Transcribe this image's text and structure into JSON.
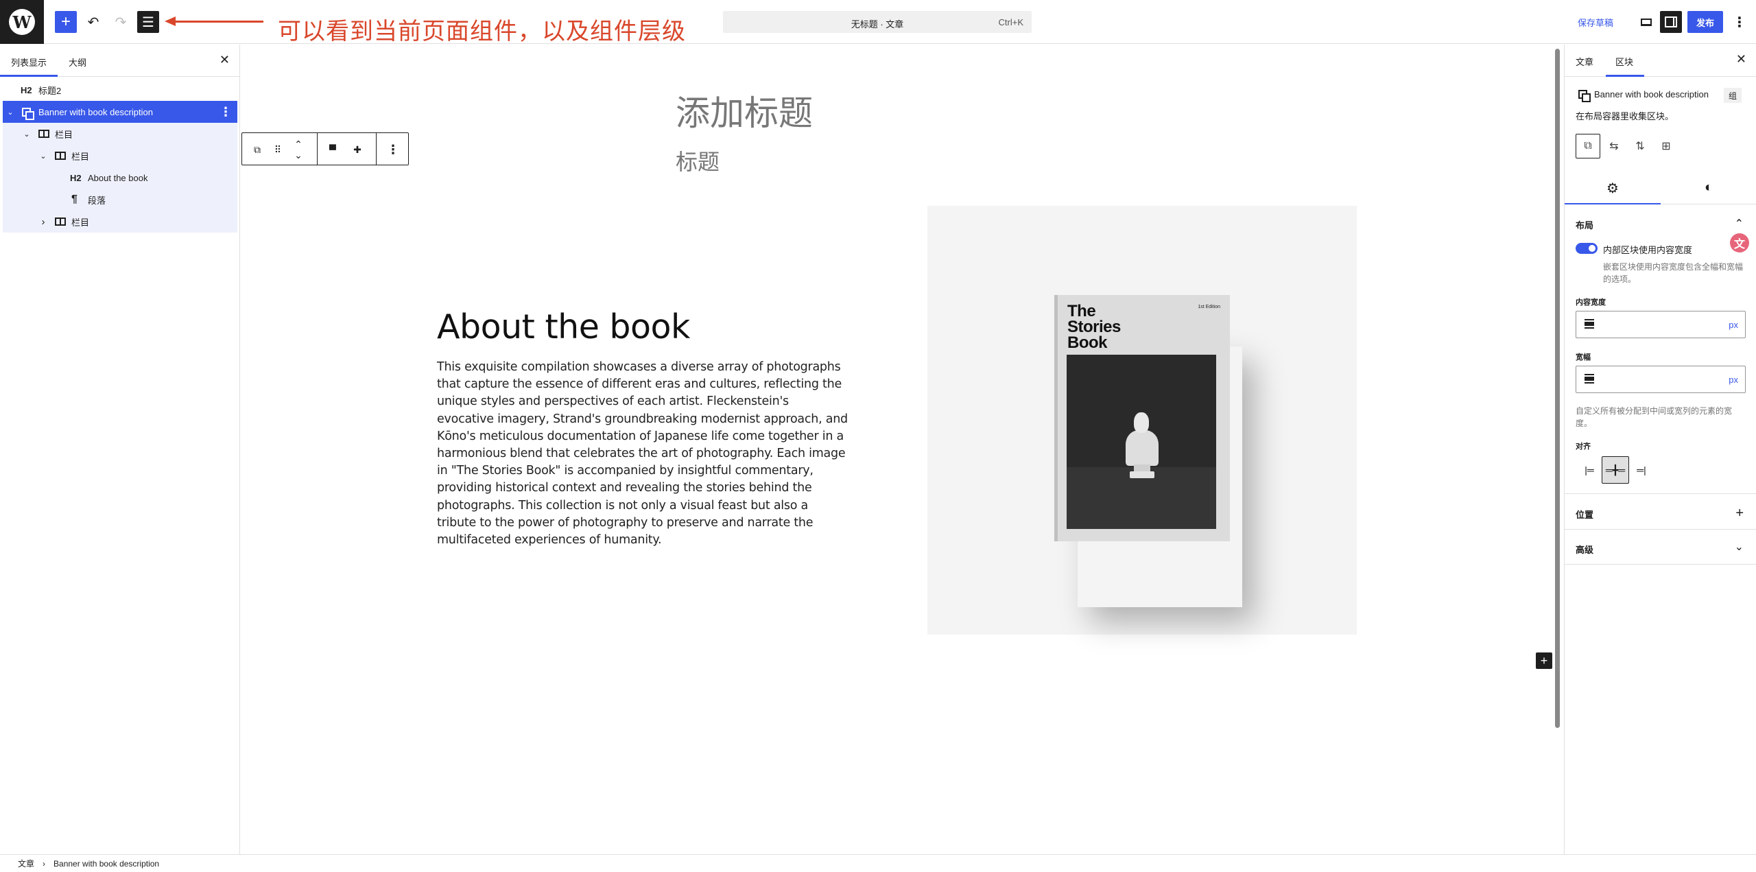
{
  "topbar": {
    "logo": "W",
    "add_icon": "+",
    "undo_icon": "↶",
    "redo_icon": "↷",
    "listview_icon": "☰",
    "annotation": "可以看到当前页面组件，以及组件层级",
    "command_title": "无标题 · 文章",
    "command_shortcut": "Ctrl+K",
    "save_draft": "保存草稿",
    "publish": "发布",
    "more_icon": "⋮",
    "annotation_color": "#d9472b",
    "accent_color": "#3858e9"
  },
  "left_panel": {
    "tab_list": "列表显示",
    "tab_outline": "大纲",
    "close_icon": "✕",
    "tree": [
      {
        "icon": "H2",
        "label": "标题2"
      },
      {
        "chevron": "⌄",
        "label": "Banner with book description",
        "more": "⋮"
      },
      {
        "chevron": "⌄",
        "label": "栏目"
      },
      {
        "chevron": "⌄",
        "label": "栏目"
      },
      {
        "icon": "H2",
        "label": "About the book"
      },
      {
        "icon": "¶",
        "label": "段落"
      },
      {
        "chevron": "›",
        "label": "栏目"
      }
    ]
  },
  "canvas": {
    "post_title": "添加标题",
    "subtitle": "标题",
    "toolbar": {
      "group_icon": "⧉",
      "drag_icon": "⠿",
      "move_up_icon": "⌃",
      "move_down_icon": "⌄",
      "wide_icon": "▀",
      "full_icon": "✚",
      "more_icon": "⋮"
    },
    "about_title": "About the book",
    "about_text": "This exquisite compilation showcases a diverse array of photographs that capture the essence of different eras and cultures, reflecting the unique styles and perspectives of each artist. Fleckenstein's evocative imagery, Strand's groundbreaking modernist approach, and Kōno's meticulous documentation of Japanese life come together in a harmonious blend that celebrates the art of photography. Each image in \"The Stories Book\" is accompanied by insightful commentary, providing historical context and revealing the stories behind the photographs. This collection is not only a visual feast but also a tribute to the power of photography to preserve and narrate the multifaceted experiences of humanity.",
    "book": {
      "title_line1": "The",
      "title_line2": "Stories",
      "title_line3": "Book",
      "edition": "1st Edition"
    },
    "inserter_icon": "+"
  },
  "right_panel": {
    "tab_post": "文章",
    "tab_block": "区块",
    "close_icon": "✕",
    "block_name": "Banner with book description",
    "block_badge": "组",
    "block_desc": "在布局容器里收集区块。",
    "variation_icons": [
      "⧉",
      "⇆",
      "⇅",
      "⊞"
    ],
    "settings_tab_icon": "⚙",
    "styles_tab_icon": "◐",
    "layout": {
      "heading": "布局",
      "collapse_icon": "⌃",
      "toggle_label": "内部区块使用内容宽度",
      "toggle_help": "嵌套区块使用内容宽度包含全幅和宽幅的选项。",
      "content_width_label": "内容宽度",
      "content_width_unit": "px",
      "wide_width_label": "宽幅",
      "wide_width_unit": "px",
      "width_help": "自定义所有被分配到中间或宽列的元素的宽度。",
      "justify_label": "对齐",
      "justify_icons": [
        "|═",
        "═╋═",
        "═|"
      ]
    },
    "position": {
      "heading": "位置",
      "expand_icon": "+"
    },
    "advanced": {
      "heading": "高级",
      "expand_icon": "⌄"
    },
    "translate_icon": "文"
  },
  "footer": {
    "crumb_root": "文章",
    "crumb_sep": "›",
    "crumb_current": "Banner with book description"
  }
}
